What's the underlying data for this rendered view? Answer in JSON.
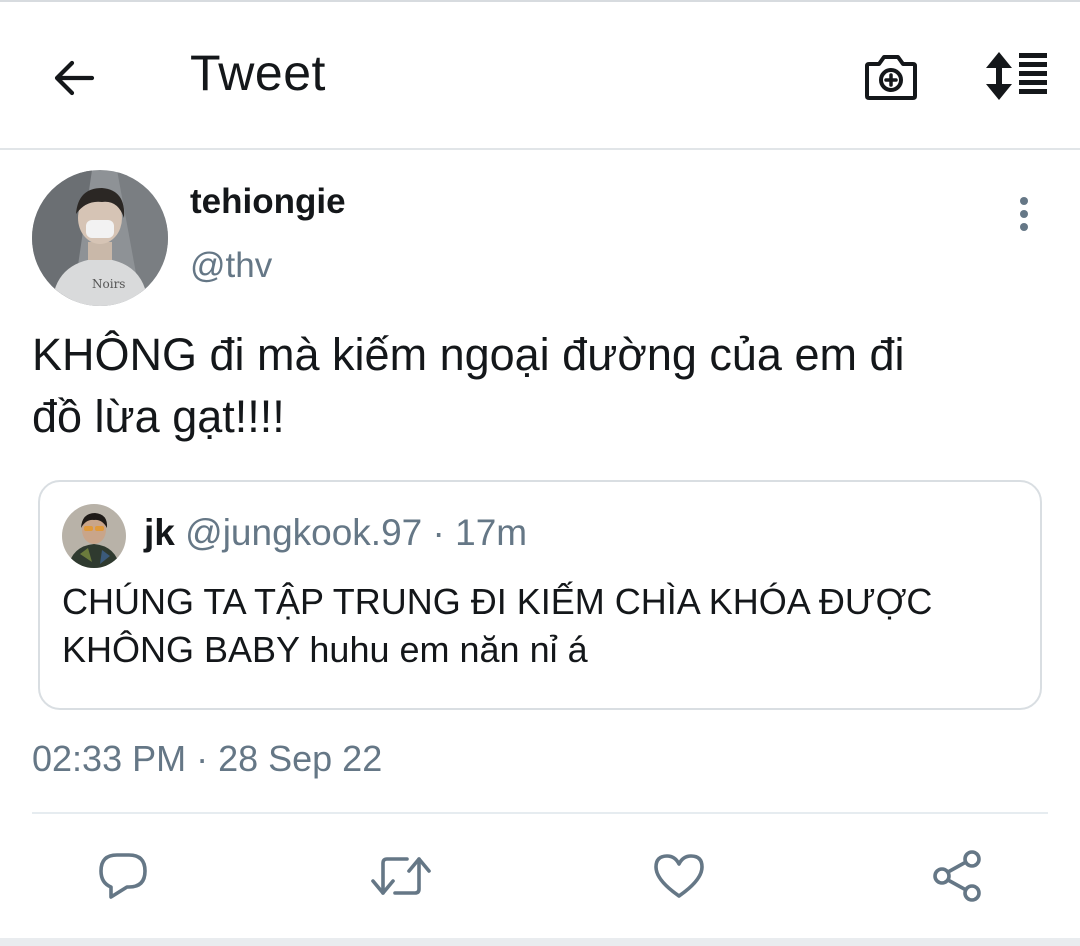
{
  "header": {
    "title": "Tweet",
    "back_icon": "arrow-left-icon",
    "camera_icon": "camera-plus-icon",
    "sort_icon": "sort-list-icon"
  },
  "tweet": {
    "display_name": "tehiongie",
    "handle": "@thv",
    "text_line1": "KHÔNG đi mà kiếm ngoại đường của em đi",
    "text_line2": "đồ lừa gạt!!!!",
    "timestamp": "02:33 PM · 28 Sep 22"
  },
  "quoted_tweet": {
    "display_name": "jk",
    "handle_time": "@jungkook.97 · 17m",
    "text_line1": "CHÚNG TA TẬP TRUNG ĐI KIẾM CHÌA KHÓA ĐƯỢC",
    "text_line2": "KHÔNG BABY huhu em năn nỉ á"
  },
  "actions": [
    "reply-icon",
    "retweet-icon",
    "like-icon",
    "share-icon"
  ],
  "colors": {
    "text_primary": "#14171a",
    "text_secondary": "#657786",
    "icon_gray": "#657786",
    "border": "#d9dee2"
  }
}
